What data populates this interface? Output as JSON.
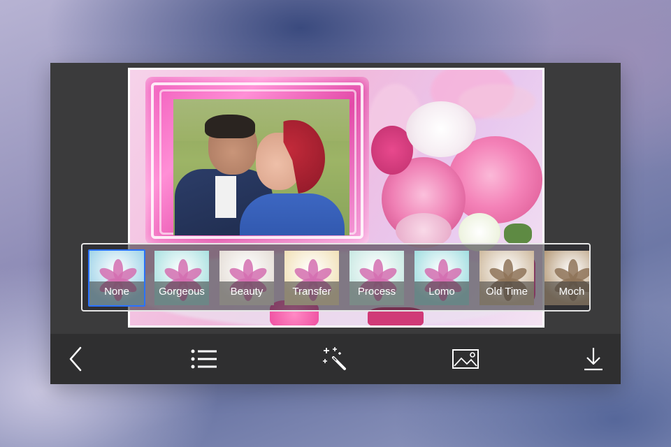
{
  "editor": {
    "filters": [
      {
        "label": "None",
        "selected": true,
        "tint": "#9ed3e8"
      },
      {
        "label": "Gorgeous",
        "selected": false,
        "tint": "#a8e0e0"
      },
      {
        "label": "Beauty",
        "selected": false,
        "tint": "#e4ddd6"
      },
      {
        "label": "Transfer",
        "selected": false,
        "tint": "#f1e0b6"
      },
      {
        "label": "Process",
        "selected": false,
        "tint": "#c7e8e2"
      },
      {
        "label": "Lomo",
        "selected": false,
        "tint": "#9fdde0"
      },
      {
        "label": "Old Time",
        "selected": false,
        "tint": "#cdb89c"
      },
      {
        "label": "Moch",
        "selected": false,
        "tint": "#b59a78"
      }
    ]
  },
  "toolbar": {
    "buttons": [
      {
        "name": "back-button",
        "icon": "chevron-left-icon"
      },
      {
        "name": "frames-list-button",
        "icon": "list-icon"
      },
      {
        "name": "effects-button",
        "icon": "magic-wand-icon"
      },
      {
        "name": "gallery-button",
        "icon": "image-icon"
      },
      {
        "name": "download-button",
        "icon": "download-icon"
      }
    ]
  },
  "colors": {
    "accent": "#2a72ff",
    "panel": "#3b3b3c",
    "toolbar": "#2f2f30"
  }
}
